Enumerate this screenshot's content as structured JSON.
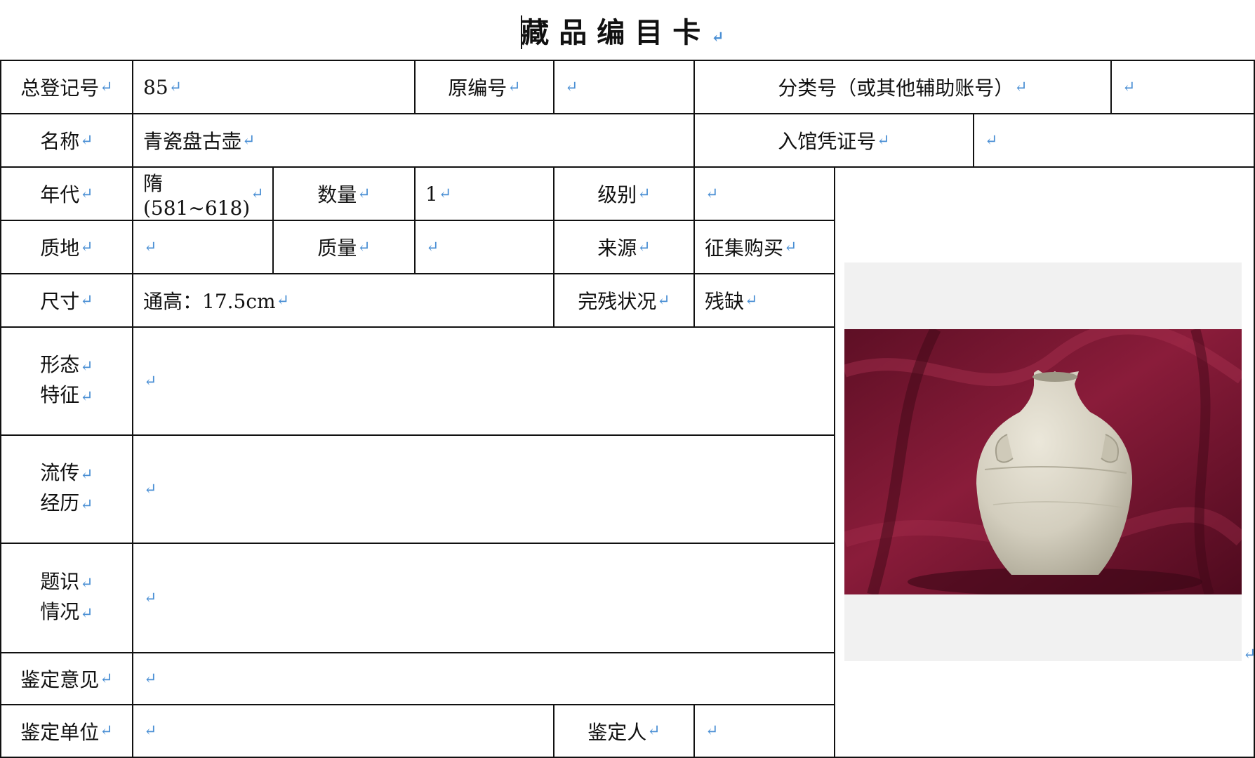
{
  "title": "藏品编目卡",
  "return_mark": "↵",
  "fields": {
    "total_reg_no": {
      "label": "总登记号",
      "value": "85"
    },
    "original_no": {
      "label": "原编号",
      "value": ""
    },
    "class_no": {
      "label": "分类号（或其他辅助账号）",
      "value": ""
    },
    "name": {
      "label": "名称",
      "value": "青瓷盘古壶"
    },
    "entry_voucher": {
      "label": "入馆凭证号",
      "value": ""
    },
    "era": {
      "label": "年代",
      "value": "隋(581~618)"
    },
    "quantity": {
      "label": "数量",
      "value": "1"
    },
    "grade": {
      "label": "级别",
      "value": ""
    },
    "texture": {
      "label": "质地",
      "value": ""
    },
    "mass": {
      "label": "质量",
      "value": ""
    },
    "source": {
      "label": "来源",
      "value": "征集购买"
    },
    "size": {
      "label": "尺寸",
      "value": "通高：17.5cm"
    },
    "condition": {
      "label": "完残状况",
      "value": "残缺"
    },
    "form": {
      "label_line1": "形态",
      "label_line2": "特征",
      "value": ""
    },
    "history": {
      "label_line1": "流传",
      "label_line2": "经历",
      "value": ""
    },
    "inscription": {
      "label_line1": "题识",
      "label_line2": "情况",
      "value": ""
    },
    "opinion": {
      "label": "鉴定意见",
      "value": ""
    },
    "unit": {
      "label": "鉴定单位",
      "value": ""
    },
    "appraiser": {
      "label": "鉴定人",
      "value": ""
    }
  },
  "colors": {
    "return_mark": "#4a8fd4",
    "backdrop": "#7a1430",
    "ceramic": "#d9d4c6"
  }
}
